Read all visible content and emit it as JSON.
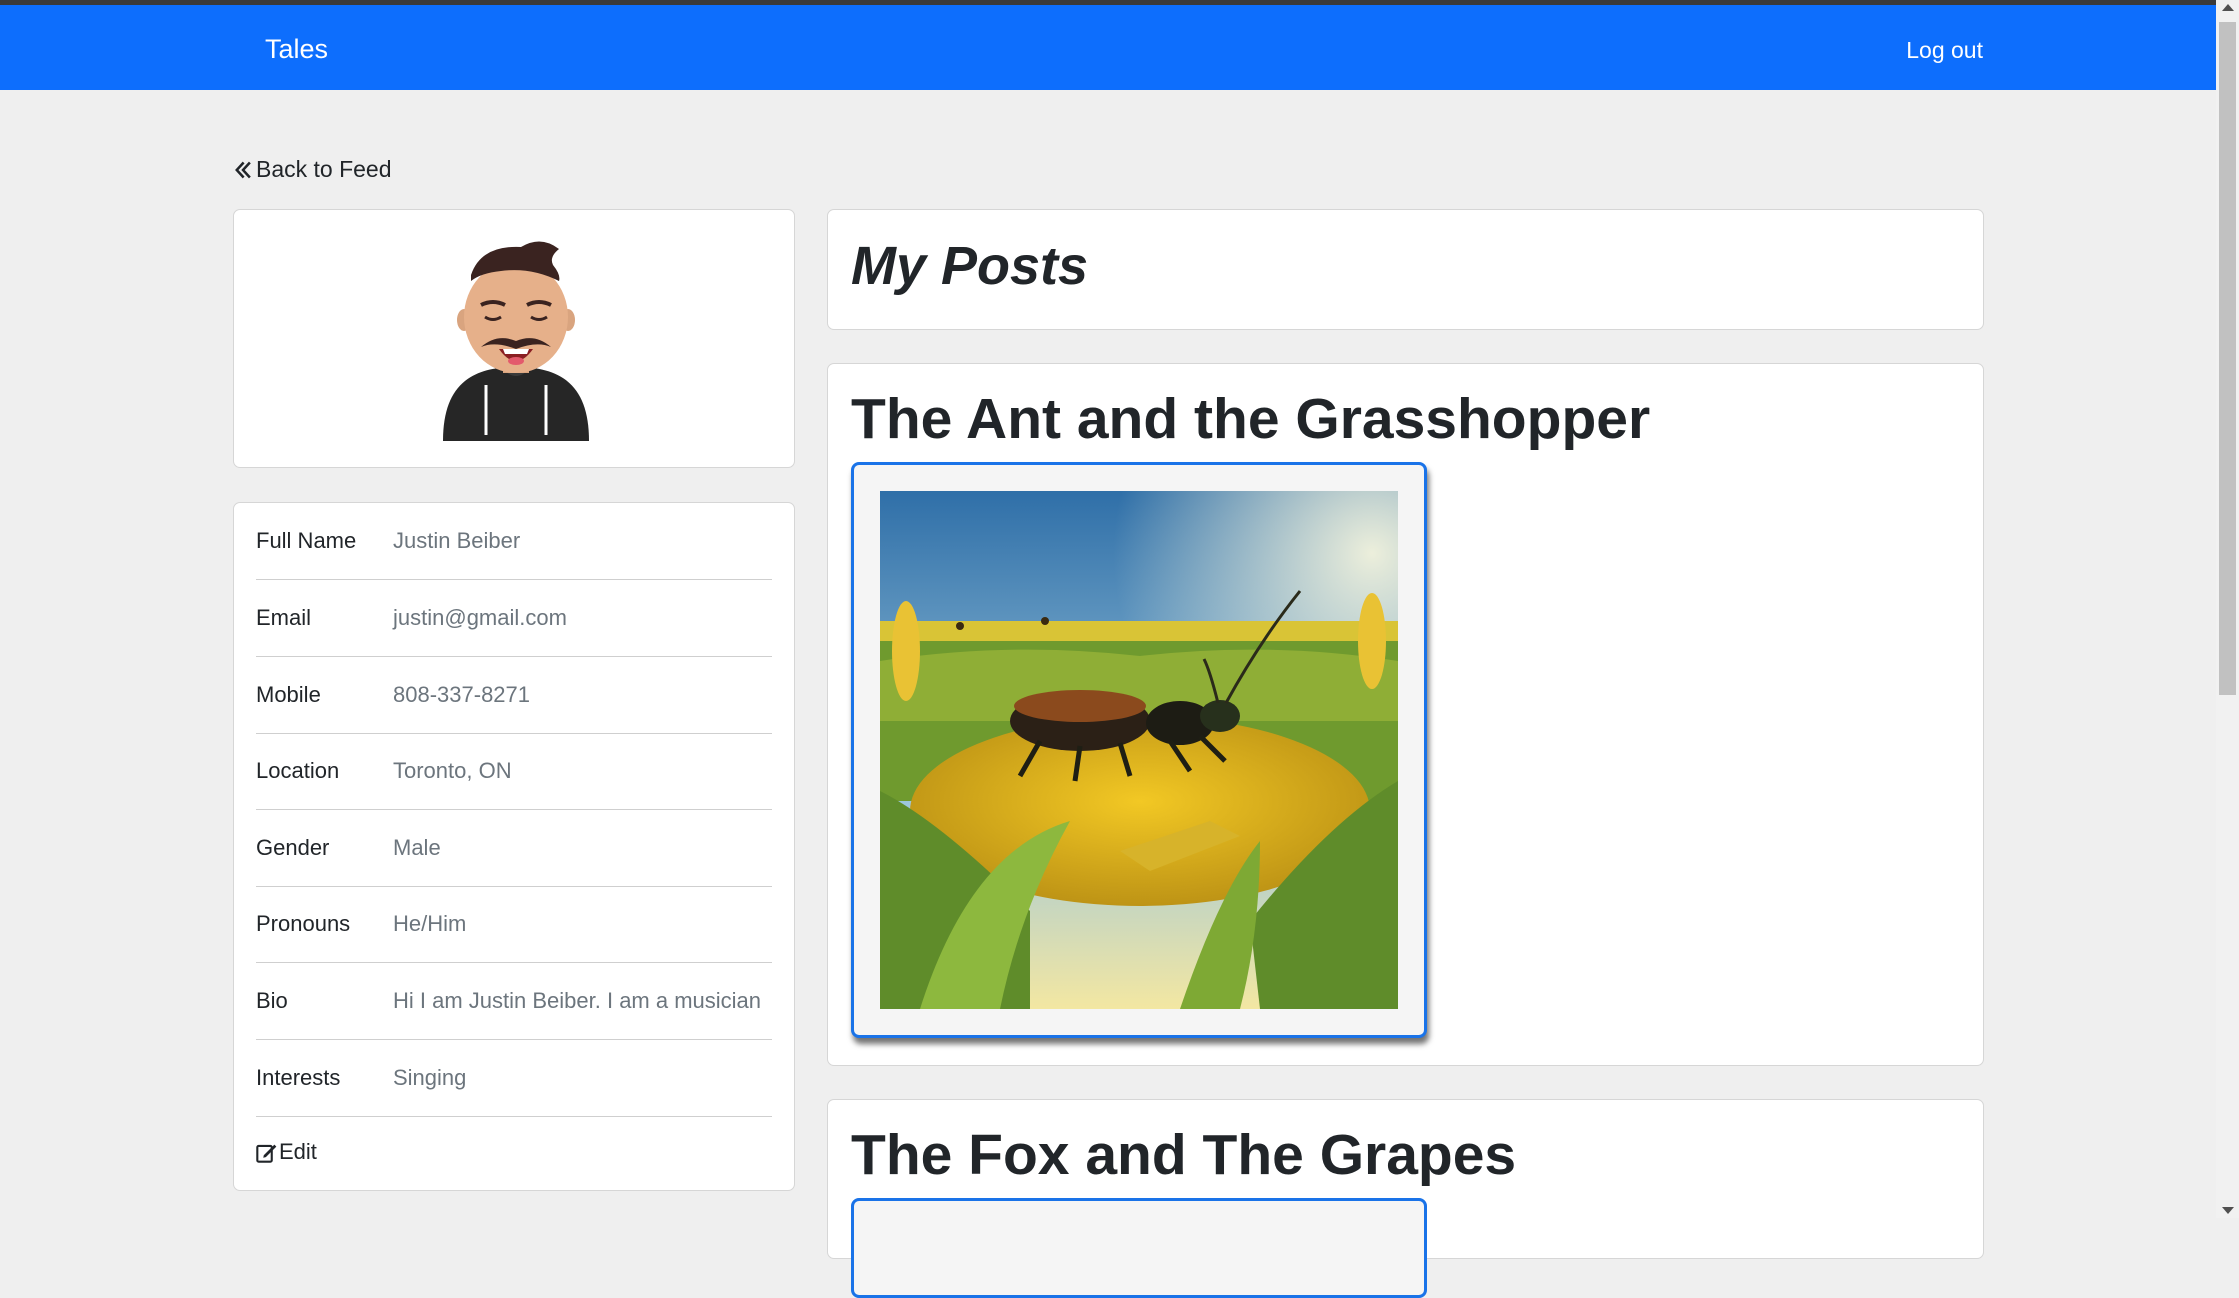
{
  "navbar": {
    "brand": "Tales",
    "logout_label": "Log out"
  },
  "back_link": {
    "label": "Back to Feed",
    "icon": "double-chevron-left-icon"
  },
  "profile": {
    "avatar": "user-avatar",
    "fields": [
      {
        "label": "Full Name",
        "value": "Justin Beiber"
      },
      {
        "label": "Email",
        "value": "justin@gmail.com"
      },
      {
        "label": "Mobile",
        "value": "808-337-8271"
      },
      {
        "label": "Location",
        "value": "Toronto, ON"
      },
      {
        "label": "Gender",
        "value": "Male"
      },
      {
        "label": "Pronouns",
        "value": "He/Him"
      },
      {
        "label": "Bio",
        "value": "Hi I am Justin Beiber. I am a musician"
      },
      {
        "label": "Interests",
        "value": "Singing"
      }
    ],
    "edit_label": "Edit",
    "edit_icon": "edit-icon"
  },
  "posts": {
    "heading": "My Posts",
    "items": [
      {
        "title": "The Ant and the Grasshopper",
        "image": "ant-in-cornfield-illustration"
      },
      {
        "title": "The Fox and The Grapes"
      }
    ]
  },
  "colors": {
    "navbar": "#0d6efd",
    "page_background": "#efefef",
    "frame_border": "#1a73e8"
  }
}
